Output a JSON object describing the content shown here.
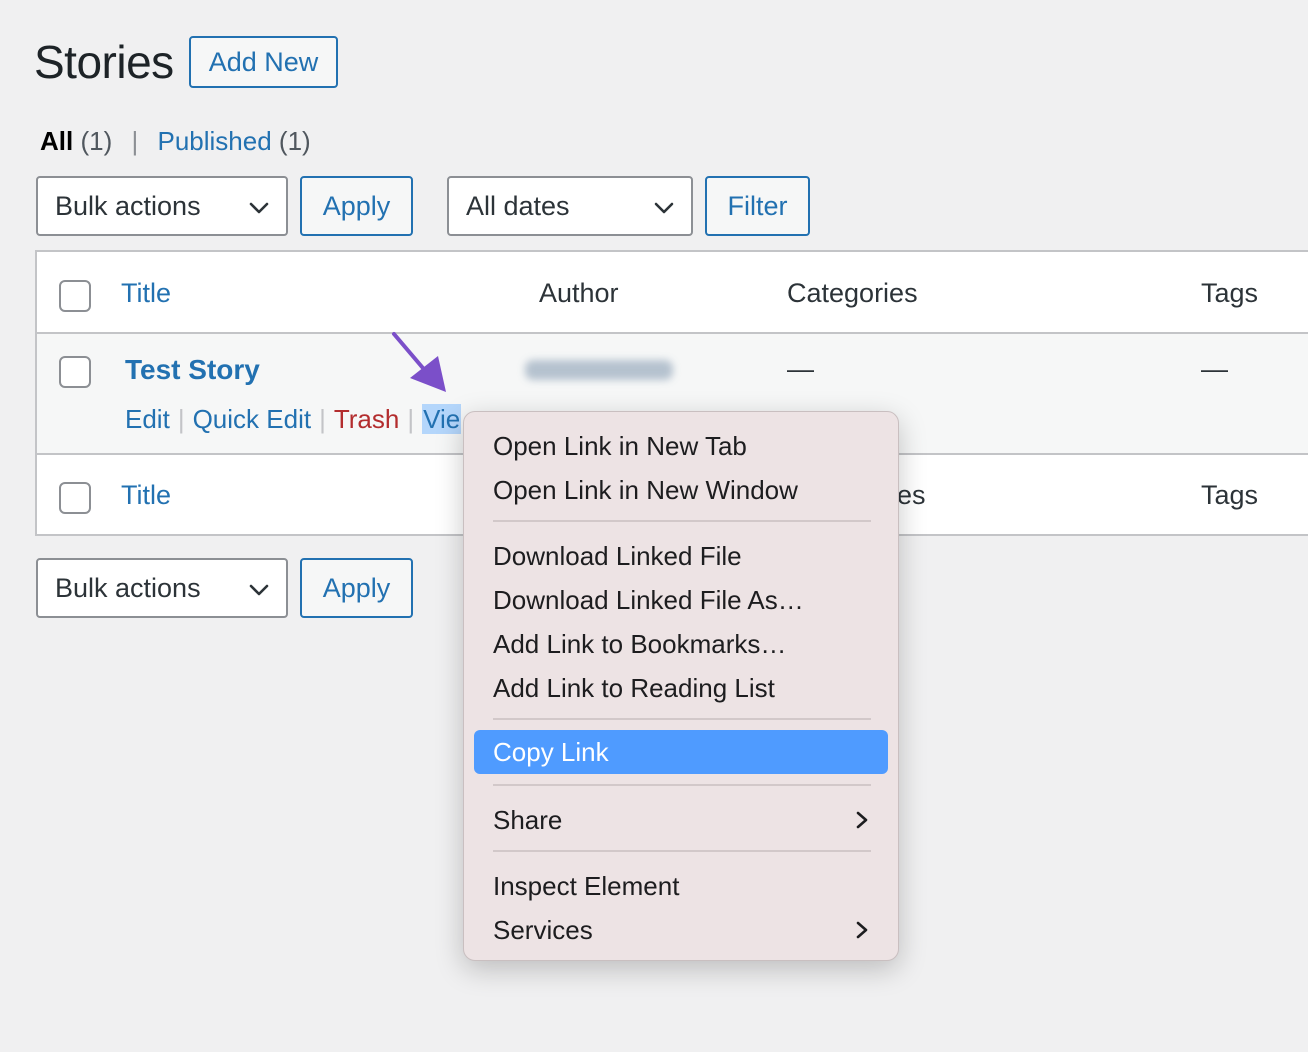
{
  "header": {
    "title": "Stories",
    "add_new": "Add New"
  },
  "views": [
    {
      "label": "All",
      "count": "(1)",
      "current": true
    },
    {
      "label": "Published",
      "count": "(1)",
      "current": false
    }
  ],
  "views_separator": "|",
  "top_nav": {
    "bulk_actions": "Bulk actions",
    "apply": "Apply",
    "dates": "All dates",
    "filter": "Filter"
  },
  "bottom_nav": {
    "bulk_actions": "Bulk actions",
    "apply": "Apply"
  },
  "table": {
    "columns": {
      "title": "Title",
      "author": "Author",
      "categories": "Categories",
      "tags": "Tags"
    },
    "row": {
      "title": "Test Story",
      "categories": "—",
      "tags": "—",
      "actions": {
        "edit": "Edit",
        "quick_edit": "Quick Edit",
        "trash": "Trash",
        "view": "Vie"
      },
      "action_separator": "|"
    },
    "footer": {
      "title": "Title",
      "categories_partial": "es",
      "tags": "Tags"
    }
  },
  "context_menu": {
    "items": [
      "Open Link in New Tab",
      "Open Link in New Window",
      "Download Linked File",
      "Download Linked File As…",
      "Add Link to Bookmarks…",
      "Add Link to Reading List",
      "Copy Link",
      "Share",
      "Inspect Element",
      "Services"
    ],
    "highlighted": "Copy Link"
  },
  "colors": {
    "link": "#2271b1",
    "trash": "#b32d2e",
    "highlight": "#4f9bff",
    "annotation_arrow": "#7b4fc9"
  }
}
